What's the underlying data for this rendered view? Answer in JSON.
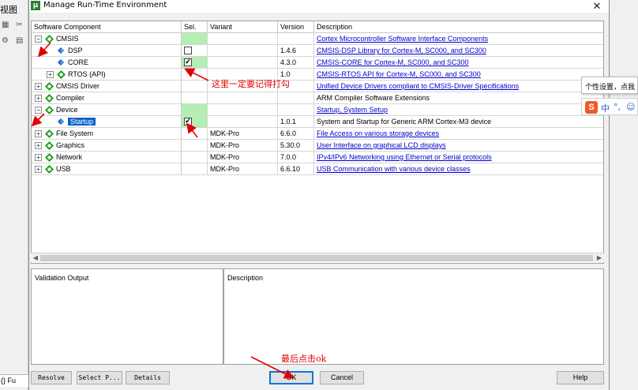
{
  "ide": {
    "menu_label": "视图",
    "code_tab": "{} Fu"
  },
  "dialog": {
    "title": "Manage Run-Time Environment",
    "close_glyph": "✕"
  },
  "columns": {
    "component": "Software Component",
    "sel": "Sel.",
    "variant": "Variant",
    "version": "Version",
    "description": "Description"
  },
  "rows": [
    {
      "name": "CMSIS",
      "level": 0,
      "expander": "−",
      "icon": "green-gem-icon",
      "sel_state": "green",
      "checked": false,
      "variant": "",
      "version": "",
      "description": "Cortex Microcontroller Software Interface Components",
      "link": true
    },
    {
      "name": "DSP",
      "level": 1,
      "expander": "",
      "icon": "blue-diamond-icon",
      "sel_state": "checkbox",
      "checked": false,
      "variant": "",
      "version": "1.4.6",
      "description": "CMSIS-DSP Library for Cortex-M, SC000, and SC300",
      "link": true
    },
    {
      "name": "CORE",
      "level": 1,
      "expander": "",
      "icon": "blue-diamond-icon",
      "sel_state": "checkbox-green",
      "checked": true,
      "variant": "",
      "version": "4.3.0",
      "description": "CMSIS-CORE for Cortex-M, SC000, and SC300",
      "link": true
    },
    {
      "name": "RTOS (API)",
      "level": 1,
      "expander": "+",
      "icon": "green-gem-icon",
      "sel_state": "none",
      "checked": false,
      "variant": "",
      "version": "1.0",
      "description": "CMSIS-RTOS API for Cortex-M, SC000, and SC300",
      "link": true
    },
    {
      "name": "CMSIS Driver",
      "level": 0,
      "expander": "+",
      "icon": "green-gem-icon",
      "sel_state": "none",
      "checked": false,
      "variant": "",
      "version": "",
      "description": "Unified Device Drivers compliant to CMSIS-Driver Specifications",
      "link": true
    },
    {
      "name": "Compiler",
      "level": 0,
      "expander": "+",
      "icon": "green-gem-icon",
      "sel_state": "none",
      "checked": false,
      "variant": "",
      "version": "",
      "description": "ARM Compiler Software Extensions",
      "link": false
    },
    {
      "name": "Device",
      "level": 0,
      "expander": "−",
      "icon": "green-gem-icon",
      "sel_state": "green",
      "checked": false,
      "variant": "",
      "version": "",
      "description": "Startup, System Setup",
      "link": true
    },
    {
      "name": "Startup",
      "level": 1,
      "expander": "",
      "icon": "blue-diamond-icon",
      "sel_state": "checkbox-green",
      "checked": true,
      "selected": true,
      "variant": "",
      "version": "1.0.1",
      "description": "System and Startup for Generic ARM Cortex-M3 device",
      "link": false
    },
    {
      "name": "File System",
      "level": 0,
      "expander": "+",
      "icon": "green-gem-icon",
      "sel_state": "none",
      "checked": false,
      "variant": "MDK-Pro",
      "version": "6.6.0",
      "description": "File Access on various storage devices",
      "link": true
    },
    {
      "name": "Graphics",
      "level": 0,
      "expander": "+",
      "icon": "green-gem-icon",
      "sel_state": "none",
      "checked": false,
      "variant": "MDK-Pro",
      "version": "5.30.0",
      "description": "User Interface on graphical LCD displays",
      "link": true
    },
    {
      "name": "Network",
      "level": 0,
      "expander": "+",
      "icon": "green-gem-icon",
      "sel_state": "none",
      "checked": false,
      "variant": "MDK-Pro",
      "version": "7.0.0",
      "description": "IPv4/IPv6 Networking using Ethernet or Serial protocols",
      "link": true
    },
    {
      "name": "USB",
      "level": 0,
      "expander": "+",
      "icon": "green-gem-icon",
      "sel_state": "none",
      "checked": false,
      "variant": "MDK-Pro",
      "version": "6.6.10",
      "description": "USB Communication with various device classes",
      "link": true
    }
  ],
  "panels": {
    "validation_output": "Validation Output",
    "description": "Description"
  },
  "buttons": {
    "resolve": "Resolve",
    "select_packs": "Select P...",
    "details": "Details",
    "ok": "OK",
    "cancel": "Cancel",
    "help": "Help"
  },
  "annotations": {
    "check_note": "这里一定要记得打勾",
    "ok_note": "最后点击ok"
  },
  "ime": {
    "tooltip": "个性设置，点我",
    "logo": "S",
    "mode": "中",
    "punct": "°,",
    "extra": "☺"
  },
  "colors": {
    "accent_blue": "#0a64c8",
    "sel_green": "#b3efb3",
    "link_blue": "#0000cc",
    "annotation_red": "#e00000",
    "gem_green": "#1ea01e"
  }
}
